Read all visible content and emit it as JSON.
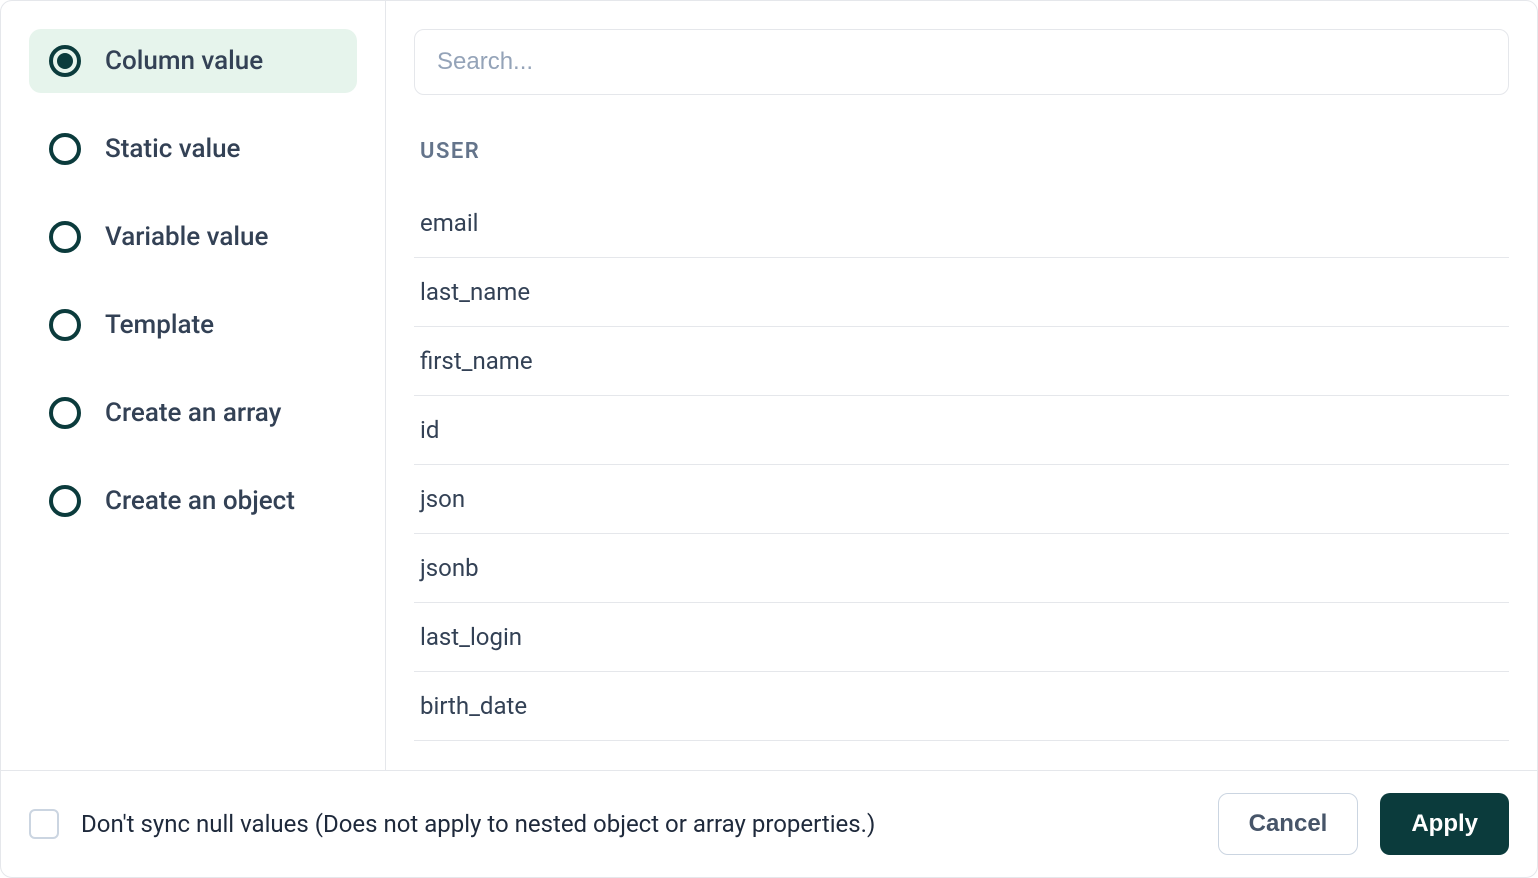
{
  "sidebar": {
    "options": [
      {
        "label": "Column value",
        "selected": true
      },
      {
        "label": "Static value",
        "selected": false
      },
      {
        "label": "Variable value",
        "selected": false
      },
      {
        "label": "Template",
        "selected": false
      },
      {
        "label": "Create an array",
        "selected": false
      },
      {
        "label": "Create an object",
        "selected": false
      }
    ]
  },
  "content": {
    "search_placeholder": "Search...",
    "group_label": "USER",
    "columns": [
      "email",
      "last_name",
      "first_name",
      "id",
      "json",
      "jsonb",
      "last_login",
      "birth_date"
    ]
  },
  "footer": {
    "checkbox_label": "Don't sync null values (Does not apply to nested object or array properties.)",
    "cancel_label": "Cancel",
    "apply_label": "Apply"
  }
}
